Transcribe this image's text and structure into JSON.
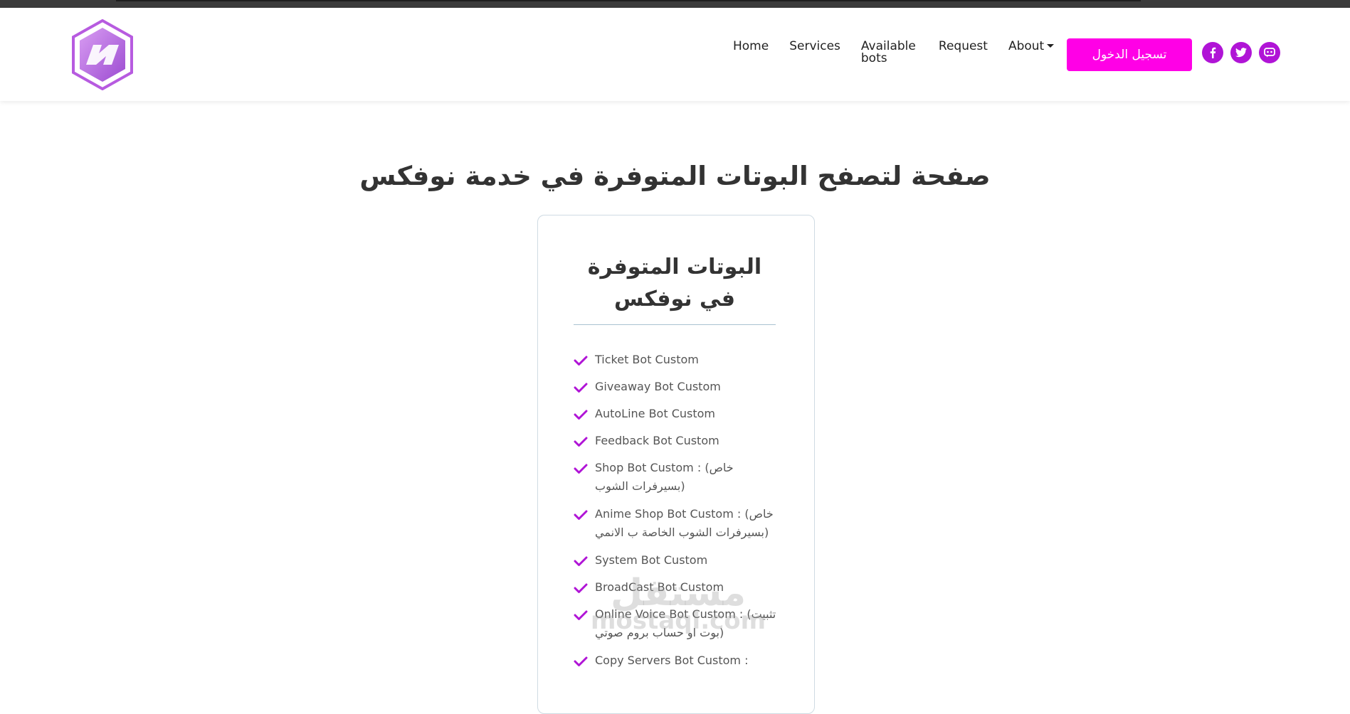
{
  "nav": {
    "items": [
      {
        "label": "Home"
      },
      {
        "label": "Services"
      },
      {
        "label": "Available bots"
      },
      {
        "label": "Request"
      },
      {
        "label": "About"
      }
    ],
    "login_label": "تسجيل الدخول"
  },
  "social": [
    "facebook-icon",
    "twitter-icon",
    "discord-icon"
  ],
  "colors": {
    "accent": "#ff00e6",
    "icon": "#b014d6",
    "check": "#b014d6"
  },
  "heading": "صفحة لتصفح البوتات المتوفرة في خدمة نوفكس",
  "card": {
    "title": "البوتات المتوفرة في نوفكس",
    "features": [
      "Ticket Bot Custom",
      "Giveaway Bot Custom",
      "AutoLine Bot Custom",
      "Feedback Bot Custom",
      "Shop Bot Custom : (خاص بسيرفرات الشوب)",
      "Anime Shop Bot Custom : (خاص بسيرفرات الشوب الخاصة ب الانمي)",
      "System Bot Custom",
      "BroadCast Bot Custom",
      "Online Voice Bot Custom : (تثبيت بوت او حساب بروم صوتي)",
      "Copy Servers Bot Custom :"
    ]
  },
  "watermark": {
    "ar": "مستقل",
    "en": "mostaql.com"
  }
}
